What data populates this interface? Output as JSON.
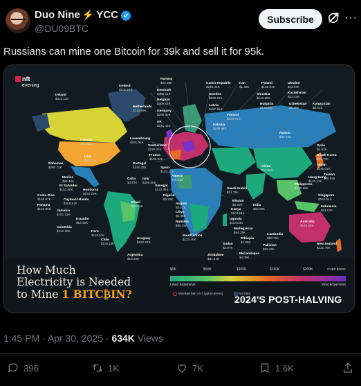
{
  "user": {
    "display_name": "Duo Nine",
    "name_suffix": "YCC",
    "handle": "@DU09BTC",
    "subscribe_label": "Subscribe"
  },
  "post": {
    "text": "Russians can mine one Bitcoin for 39k and sell it for 95k.",
    "time": "1:45 PM",
    "date": "Apr 30, 2025",
    "views_count": "634K",
    "views_label": "Views"
  },
  "actions": {
    "replies": "396",
    "reposts": "1K",
    "likes": "7K",
    "bookmarks": "1.6K"
  },
  "infographic": {
    "brand_line1": "nft",
    "brand_line2": "evening",
    "title_line1": "How Much",
    "title_line2": "Electricity is Needed",
    "title_line3_a": "to Mine ",
    "title_line3_b": "1 BITC₿IN?",
    "legend_ticks": [
      "$0K",
      "$50K",
      "$100K",
      "$150K",
      "$200K",
      "OVER $200K"
    ],
    "legend_low": "Least Expensive",
    "legend_high": "Most Expensive",
    "legend_banned": "Absolute ban on Cryptocurrency",
    "legend_nodata": "No Data",
    "badge": "2024'S POST-HALVING",
    "labels": [
      {
        "name": "Iceland",
        "value": "$32.11K"
      },
      {
        "name": "Ireland",
        "value": "$321.11K"
      },
      {
        "name": "Norway",
        "value": "$94.88K"
      },
      {
        "name": "Iceland",
        "value": "$102.61K"
      },
      {
        "name": "Denmark",
        "value": "$358.21K"
      },
      {
        "name": "Belgium",
        "value": "$309.42K"
      },
      {
        "name": "Netherlands",
        "value": "$213.59K"
      },
      {
        "name": "Germany",
        "value": "$280.00K"
      },
      {
        "name": "UK",
        "value": "$221.46K"
      },
      {
        "name": "Czech Republic",
        "value": "$228.42K"
      },
      {
        "name": "Iran",
        "value": "$1.32K"
      },
      {
        "name": "Poland",
        "value": "$158.91K"
      },
      {
        "name": "Ukraine",
        "value": "$42.57K"
      },
      {
        "name": "Sweden",
        "value": "$160.23K"
      },
      {
        "name": "Slovakia",
        "value": "$141.69K"
      },
      {
        "name": "Kazakhstan",
        "value": "$32.44K"
      },
      {
        "name": "Latvia",
        "value": "$197.96K"
      },
      {
        "name": "Bulgaria",
        "value": "$112.65K"
      },
      {
        "name": "Uzbekistan",
        "value": "$5.29K"
      },
      {
        "name": "Kyrgyzstan",
        "value": "$8.61K"
      },
      {
        "name": "Finland",
        "value": "$130.74K"
      },
      {
        "name": "Estonia",
        "value": "$189.96K"
      },
      {
        "name": "Russia",
        "value": "$39.73K"
      },
      {
        "name": "Canada",
        "value": "$64.49K"
      },
      {
        "name": "USA",
        "value": "$92.24K"
      },
      {
        "name": "Luxembourg",
        "value": "$181.55K"
      },
      {
        "name": "Switzerland",
        "value": "$230.32K"
      },
      {
        "name": "France",
        "value": "$190.02K"
      },
      {
        "name": "Portugal",
        "value": "$145.32K"
      },
      {
        "name": "Spain",
        "value": "$183.21K"
      },
      {
        "name": "Italy",
        "value": "$306.55K"
      },
      {
        "name": "China",
        "value": "$50.96K"
      },
      {
        "name": "Syria",
        "value": "$5.97K"
      },
      {
        "name": "South Korea",
        "value": "$86.73K"
      },
      {
        "name": "Japan",
        "value": "$145.01K"
      },
      {
        "name": "Taiwan",
        "value": "$60.91K"
      },
      {
        "name": "Bahamas",
        "value": "$280.72K"
      },
      {
        "name": "Mexico",
        "value": "$64.49K"
      },
      {
        "name": "El Salvador",
        "value": "$153.60K"
      },
      {
        "name": "Honduras",
        "value": "$150.29K"
      },
      {
        "name": "Cuba",
        "value": "$3.97K"
      },
      {
        "name": "Algeria",
        "value": "$10.83K"
      },
      {
        "name": "Senegal",
        "value": "$122.49K"
      },
      {
        "name": "Costa Rica",
        "value": "$155.87K"
      },
      {
        "name": "Cayman Islands",
        "value": "$368.81K"
      },
      {
        "name": "Jamaica",
        "value": "$181.41K"
      },
      {
        "name": "Panama",
        "value": "$131.96K"
      },
      {
        "name": "Ecuador",
        "value": "$63.56K"
      },
      {
        "name": "Colombia",
        "value": "$122.28K"
      },
      {
        "name": "Peru",
        "value": "$116.53K"
      },
      {
        "name": "Chile",
        "value": "$118.16K"
      },
      {
        "name": "Brazil",
        "value": "$89.71K"
      },
      {
        "name": "Uruguay",
        "value": "$160.23K"
      },
      {
        "name": "Argentina",
        "value": "$13.38K"
      },
      {
        "name": "Nigeria",
        "value": "$9.23K"
      },
      {
        "name": "Angola",
        "value": "$8.61K"
      },
      {
        "name": "Libya",
        "value": "$5.36K"
      },
      {
        "name": "Namibia",
        "value": "$95.34K"
      },
      {
        "name": "South Africa",
        "value": "$123.49K"
      },
      {
        "name": "Zimbabwe",
        "value": "$81.41K"
      },
      {
        "name": "Sudan",
        "value": "$3.97K"
      },
      {
        "name": "Mozambique",
        "value": "$4.09K"
      },
      {
        "name": "Ethiopia",
        "value": "$1.99K"
      },
      {
        "name": "Madagascar",
        "value": "$94.25K"
      },
      {
        "name": "Uganda",
        "value": "$114.54K"
      },
      {
        "name": "Kenya",
        "value": "$103.54K"
      },
      {
        "name": "Bhutan",
        "value": "$6.93K"
      },
      {
        "name": "Saudi Arabia",
        "value": "$31.76K"
      },
      {
        "name": "India",
        "value": "$50.98K"
      },
      {
        "name": "Pakistan",
        "value": "$29.45K"
      },
      {
        "name": "Cambodia",
        "value": "$99.76K"
      },
      {
        "name": "Hong Kong",
        "value": "$125.13K"
      },
      {
        "name": "Philippines",
        "value": "$136.36K"
      },
      {
        "name": "Singapore",
        "value": "$156.91K"
      },
      {
        "name": "Indonesia",
        "value": "$61.57K"
      },
      {
        "name": "Australia",
        "value": "$144.59K"
      },
      {
        "name": "New Zealand",
        "value": "$131.76K"
      }
    ]
  }
}
